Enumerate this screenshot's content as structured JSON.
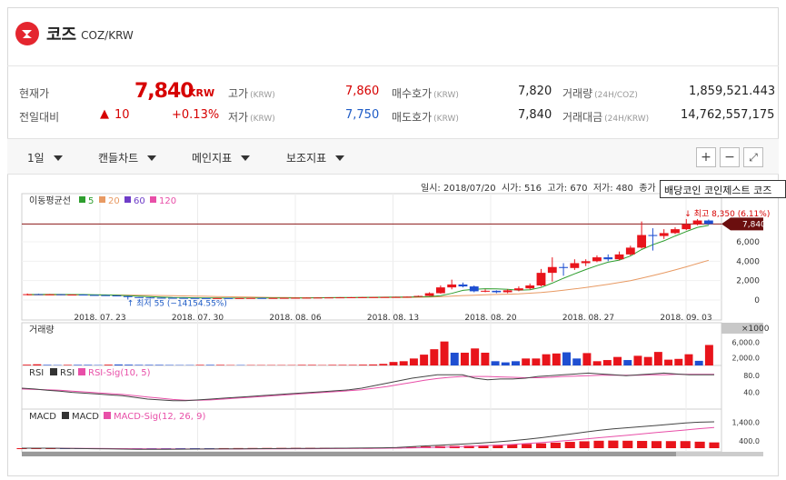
{
  "coin": {
    "name": "코즈",
    "pair": "COZ/KRW"
  },
  "quote": {
    "current_label": "현재가",
    "current_value": "7,840",
    "current_unit": "KRW",
    "change_label": "전일대비",
    "change_arrow": "▲",
    "change_value": "10",
    "change_pct": "+0.13%",
    "high_label": "고가",
    "high_unit": "(KRW)",
    "high_value": "7,860",
    "low_label": "저가",
    "low_unit": "(KRW)",
    "low_value": "7,750",
    "bid_label": "매수호가",
    "bid_unit": "(KRW)",
    "bid_value": "7,820",
    "ask_label": "매도호가",
    "ask_unit": "(KRW)",
    "ask_value": "7,840",
    "volume_label": "거래량",
    "volume_unit": "(24H/COZ)",
    "volume_value": "1,859,521.443",
    "amount_label": "거래대금",
    "amount_unit": "(24H/KRW)",
    "amount_value": "14,762,557,175"
  },
  "toolbar": {
    "period": "1일",
    "chart_type": "캔들차트",
    "main_indicator": "메인지표",
    "sub_indicator": "보조지표",
    "zoom_in": "+",
    "zoom_out": "−",
    "fullscreen": "⤢"
  },
  "ohlc": {
    "date_label": "일시:",
    "date": "2018/07/20",
    "open_label": "시가:",
    "open": "516",
    "high_label": "고가:",
    "high": "670",
    "low_label": "저가:",
    "low": "480",
    "vol_label": "종가"
  },
  "tooltip": "배당코인 코인제스트 코즈",
  "colors": {
    "up": "#e8141b",
    "down": "#1f4fd1",
    "ma5": "#2e9e2e",
    "ma20": "#e89a63",
    "ma60": "#6f3dc8",
    "ma120": "#e84fa8"
  },
  "chart_data": {
    "type": "candlestick",
    "price_panel": {
      "legend_title": "이동평균선",
      "legend": [
        {
          "name": "5"
        },
        {
          "name": "20"
        },
        {
          "name": "60"
        },
        {
          "name": "120"
        }
      ],
      "y_ticks": [
        "6,000",
        "4,000",
        "2,000",
        "0"
      ],
      "ylim": [
        0,
        9000
      ],
      "current_price_label": "7,840",
      "high_annotation": "↓ 최고 8,350 (6.11%)",
      "low_annotation": "↑ 최저 55 (−14154.55%)",
      "candles": [
        {
          "o": 516,
          "c": 600,
          "h": 670,
          "l": 480
        },
        {
          "o": 600,
          "c": 560,
          "h": 640,
          "l": 520
        },
        {
          "o": 560,
          "c": 590,
          "h": 620,
          "l": 540
        },
        {
          "o": 590,
          "c": 540,
          "h": 610,
          "l": 500
        },
        {
          "o": 540,
          "c": 560,
          "h": 580,
          "l": 520
        },
        {
          "o": 560,
          "c": 520,
          "h": 580,
          "l": 490
        },
        {
          "o": 520,
          "c": 500,
          "h": 540,
          "l": 480
        },
        {
          "o": 500,
          "c": 470,
          "h": 520,
          "l": 440
        },
        {
          "o": 470,
          "c": 400,
          "h": 480,
          "l": 380
        },
        {
          "o": 400,
          "c": 300,
          "h": 410,
          "l": 55
        },
        {
          "o": 300,
          "c": 260,
          "h": 310,
          "l": 240
        },
        {
          "o": 260,
          "c": 240,
          "h": 280,
          "l": 220
        },
        {
          "o": 240,
          "c": 230,
          "h": 260,
          "l": 210
        },
        {
          "o": 230,
          "c": 220,
          "h": 250,
          "l": 200
        },
        {
          "o": 220,
          "c": 210,
          "h": 240,
          "l": 190
        },
        {
          "o": 210,
          "c": 200,
          "h": 230,
          "l": 180
        },
        {
          "o": 200,
          "c": 190,
          "h": 220,
          "l": 170
        },
        {
          "o": 190,
          "c": 200,
          "h": 220,
          "l": 170
        },
        {
          "o": 200,
          "c": 190,
          "h": 220,
          "l": 170
        },
        {
          "o": 190,
          "c": 200,
          "h": 210,
          "l": 180
        },
        {
          "o": 200,
          "c": 210,
          "h": 230,
          "l": 190
        },
        {
          "o": 210,
          "c": 200,
          "h": 230,
          "l": 190
        },
        {
          "o": 200,
          "c": 210,
          "h": 220,
          "l": 190
        },
        {
          "o": 210,
          "c": 220,
          "h": 240,
          "l": 200
        },
        {
          "o": 220,
          "c": 230,
          "h": 250,
          "l": 210
        },
        {
          "o": 230,
          "c": 240,
          "h": 260,
          "l": 220
        },
        {
          "o": 240,
          "c": 250,
          "h": 270,
          "l": 230
        },
        {
          "o": 250,
          "c": 260,
          "h": 280,
          "l": 240
        },
        {
          "o": 260,
          "c": 270,
          "h": 290,
          "l": 250
        },
        {
          "o": 270,
          "c": 280,
          "h": 300,
          "l": 260
        },
        {
          "o": 280,
          "c": 290,
          "h": 310,
          "l": 270
        },
        {
          "o": 290,
          "c": 300,
          "h": 320,
          "l": 280
        },
        {
          "o": 300,
          "c": 310,
          "h": 330,
          "l": 290
        },
        {
          "o": 310,
          "c": 320,
          "h": 340,
          "l": 300
        },
        {
          "o": 320,
          "c": 340,
          "h": 360,
          "l": 310
        },
        {
          "o": 340,
          "c": 420,
          "h": 460,
          "l": 330
        },
        {
          "o": 420,
          "c": 700,
          "h": 800,
          "l": 400
        },
        {
          "o": 700,
          "c": 1300,
          "h": 1500,
          "l": 650
        },
        {
          "o": 1300,
          "c": 1600,
          "h": 2100,
          "l": 1100
        },
        {
          "o": 1600,
          "c": 1400,
          "h": 1800,
          "l": 1300
        },
        {
          "o": 1400,
          "c": 900,
          "h": 1500,
          "l": 800
        },
        {
          "o": 900,
          "c": 950,
          "h": 1100,
          "l": 800
        },
        {
          "o": 950,
          "c": 800,
          "h": 1000,
          "l": 700
        },
        {
          "o": 800,
          "c": 1000,
          "h": 1100,
          "l": 700
        },
        {
          "o": 1000,
          "c": 1200,
          "h": 1400,
          "l": 900
        },
        {
          "o": 1200,
          "c": 1500,
          "h": 1700,
          "l": 1100
        },
        {
          "o": 1500,
          "c": 2800,
          "h": 3200,
          "l": 1400
        },
        {
          "o": 2800,
          "c": 3400,
          "h": 4400,
          "l": 1900
        },
        {
          "o": 3400,
          "c": 3300,
          "h": 3800,
          "l": 2500
        },
        {
          "o": 3300,
          "c": 3800,
          "h": 4200,
          "l": 3100
        },
        {
          "o": 3800,
          "c": 4000,
          "h": 4200,
          "l": 3500
        },
        {
          "o": 4000,
          "c": 4400,
          "h": 4600,
          "l": 3900
        },
        {
          "o": 4400,
          "c": 4200,
          "h": 4700,
          "l": 4000
        },
        {
          "o": 4200,
          "c": 4700,
          "h": 5000,
          "l": 4100
        },
        {
          "o": 4700,
          "c": 5400,
          "h": 5600,
          "l": 4600
        },
        {
          "o": 5400,
          "c": 6700,
          "h": 8100,
          "l": 5300
        },
        {
          "o": 6700,
          "c": 6600,
          "h": 7400,
          "l": 5100
        },
        {
          "o": 6600,
          "c": 6900,
          "h": 7300,
          "l": 6300
        },
        {
          "o": 6900,
          "c": 7300,
          "h": 7500,
          "l": 6800
        },
        {
          "o": 7300,
          "c": 7800,
          "h": 8350,
          "l": 7200
        },
        {
          "o": 7800,
          "c": 8200,
          "h": 8350,
          "l": 7700
        },
        {
          "o": 8200,
          "c": 7840,
          "h": 8300,
          "l": 7750
        }
      ],
      "ma5": [
        560,
        570,
        575,
        570,
        565,
        560,
        545,
        525,
        495,
        445,
        400,
        350,
        295,
        255,
        240,
        225,
        215,
        205,
        200,
        198,
        200,
        202,
        204,
        206,
        210,
        220,
        230,
        240,
        250,
        260,
        270,
        280,
        290,
        300,
        310,
        330,
        360,
        450,
        680,
        990,
        1100,
        1160,
        1150,
        1100,
        1000,
        1050,
        1290,
        1740,
        2240,
        2700,
        3140,
        3540,
        3900,
        4120,
        4540,
        5200,
        5700,
        6100,
        6600,
        7060,
        7490,
        7700
      ],
      "ma20": [
        520,
        520,
        520,
        520,
        520,
        520,
        520,
        520,
        520,
        510,
        500,
        480,
        460,
        440,
        420,
        400,
        380,
        360,
        340,
        320,
        300,
        280,
        260,
        250,
        240,
        235,
        232,
        232,
        234,
        236,
        240,
        246,
        252,
        258,
        266,
        280,
        300,
        340,
        400,
        460,
        500,
        540,
        570,
        600,
        640,
        700,
        780,
        880,
        1000,
        1140,
        1290,
        1450,
        1620,
        1800,
        2000,
        2250,
        2520,
        2800,
        3100,
        3420,
        3760,
        4100
      ],
      "x_ticks": [
        "2018. 07. 23",
        "2018. 07. 30",
        "2018. 08. 06",
        "2018. 08. 13",
        "2018. 08. 20",
        "2018. 08. 27",
        "2018. 09. 03"
      ]
    },
    "volume_panel": {
      "title": "거래량",
      "unit_label": "×1000",
      "y_ticks": [
        "6,000.0",
        "2,000.0"
      ],
      "ylim": [
        0,
        8000
      ],
      "values": [
        200,
        300,
        150,
        100,
        150,
        150,
        150,
        100,
        200,
        250,
        200,
        150,
        150,
        150,
        120,
        100,
        100,
        150,
        150,
        150,
        100,
        100,
        100,
        100,
        100,
        100,
        100,
        150,
        150,
        100,
        150,
        150,
        150,
        200,
        250,
        400,
        900,
        1100,
        1800,
        2800,
        4200,
        6200,
        3300,
        3300,
        4400,
        3300,
        1100,
        800,
        1100,
        1800,
        1800,
        2900,
        3100,
        3400,
        1800,
        3200,
        1100,
        1400,
        2200,
        1400,
        2500,
        2200,
        3500,
        1500,
        1700,
        2900,
        1200,
        5300
      ],
      "up": [
        1,
        1,
        0,
        0,
        1,
        0,
        0,
        0,
        1,
        0,
        0,
        0,
        0,
        0,
        0,
        0,
        0,
        1,
        0,
        1,
        1,
        0,
        1,
        1,
        1,
        1,
        1,
        1,
        1,
        1,
        1,
        1,
        1,
        1,
        1,
        1,
        1,
        1,
        1,
        1,
        1,
        1,
        0,
        1,
        1,
        1,
        0,
        0,
        0,
        1,
        1,
        1,
        1,
        0,
        0,
        1,
        1,
        1,
        1,
        0,
        1,
        1,
        1,
        1,
        1,
        1,
        0,
        1
      ]
    },
    "rsi_panel": {
      "title": "RSI",
      "legend": [
        {
          "name": "RSI"
        },
        {
          "name": "RSI-Sig(10, 5)"
        }
      ],
      "y_ticks": [
        "80.0",
        "40.0"
      ],
      "ylim": [
        0,
        100
      ],
      "rsi": [
        50,
        48,
        45,
        43,
        40,
        38,
        36,
        34,
        32,
        28,
        24,
        22,
        20,
        20,
        22,
        24,
        26,
        28,
        30,
        32,
        34,
        36,
        38,
        40,
        42,
        44,
        46,
        50,
        56,
        62,
        68,
        74,
        78,
        82,
        82,
        82,
        74,
        70,
        72,
        72,
        74,
        78,
        80,
        82,
        84,
        86,
        84,
        82,
        80,
        82,
        84,
        86,
        84,
        82,
        82,
        82
      ],
      "sig": [
        48,
        47,
        46,
        45,
        43,
        41,
        39,
        37,
        35,
        32,
        29,
        26,
        23,
        21,
        21,
        22,
        24,
        26,
        28,
        30,
        32,
        34,
        36,
        38,
        40,
        42,
        44,
        46,
        50,
        54,
        59,
        64,
        69,
        73,
        76,
        78,
        78,
        78,
        77,
        76,
        75,
        75,
        76,
        78,
        79,
        80,
        81,
        81,
        81,
        81,
        82,
        82,
        83,
        83,
        83,
        83
      ]
    },
    "macd_panel": {
      "title": "MACD",
      "legend": [
        {
          "name": "MACD"
        },
        {
          "name": "MACD-Sig(12, 26, 9)"
        }
      ],
      "y_ticks": [
        "1,400.0",
        "400.0"
      ],
      "ylim": [
        0,
        2200
      ],
      "macd": [
        0,
        0,
        0,
        -10,
        -20,
        -30,
        -40,
        -50,
        -60,
        -60,
        -60,
        -55,
        -50,
        -45,
        -40,
        -35,
        -30,
        -25,
        -20,
        -15,
        -10,
        -5,
        0,
        5,
        10,
        20,
        40,
        80,
        120,
        160,
        200,
        240,
        290,
        340,
        400,
        480,
        560,
        660,
        760,
        860,
        960,
        1040,
        1100,
        1160,
        1220,
        1290,
        1360,
        1400,
        1420
      ],
      "signal": [
        0,
        0,
        0,
        -5,
        -10,
        -15,
        -20,
        -25,
        -30,
        -35,
        -40,
        -42,
        -44,
        -44,
        -44,
        -42,
        -40,
        -37,
        -34,
        -31,
        -27,
        -23,
        -19,
        -15,
        -10,
        -5,
        3,
        15,
        30,
        50,
        75,
        100,
        130,
        160,
        200,
        250,
        300,
        360,
        420,
        490,
        560,
        630,
        700,
        770,
        840,
        910,
        980,
        1050,
        1110
      ],
      "hist": [
        0,
        0,
        0,
        -5,
        -10,
        -15,
        -20,
        -25,
        -30,
        -25,
        -20,
        -13,
        -6,
        -1,
        4,
        7,
        10,
        12,
        14,
        16,
        17,
        18,
        19,
        20,
        20,
        25,
        37,
        65,
        90,
        110,
        125,
        140,
        160,
        180,
        200,
        230,
        260,
        300,
        340,
        370,
        400,
        410,
        400,
        390,
        380,
        380,
        380,
        350,
        310
      ]
    }
  }
}
